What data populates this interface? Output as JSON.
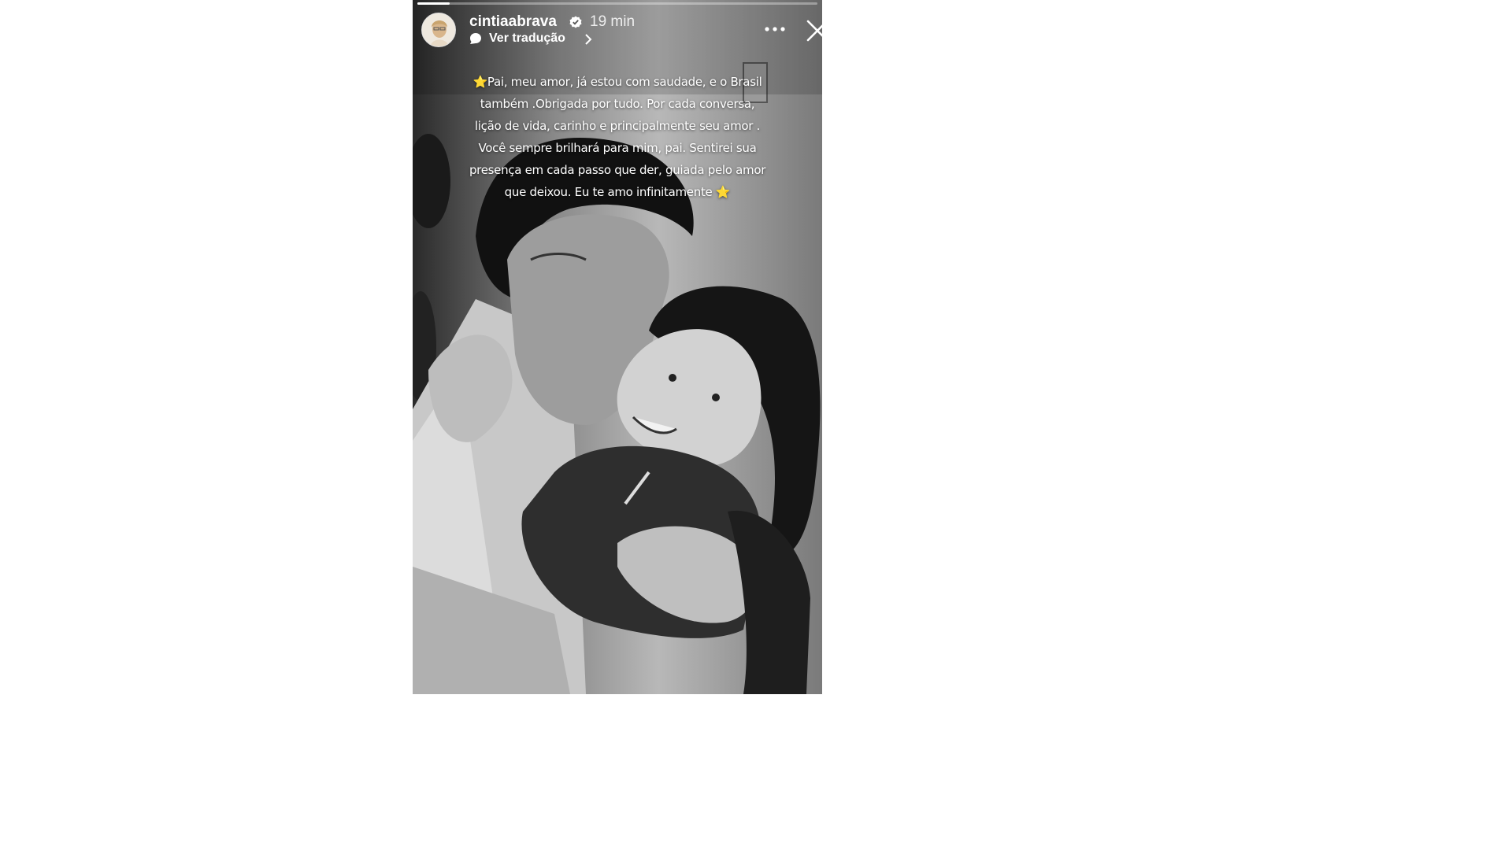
{
  "story": {
    "username": "cintiaabrava",
    "verified": true,
    "time_ago": "19 min",
    "translate_label": "Ver tradução",
    "progress": 0.08,
    "caption": "⭐Pai, meu amor, já estou com saudade, e o Brasil também .Obrigada por tudo. Por cada conversa, lição de vida, carinho e principalmente seu amor . Você sempre brilhará para mim, pai. Sentirei sua presença em cada passo que der, guiada pelo amor que deixou. Eu te amo infinitamente ⭐"
  },
  "icons": {
    "verified": "verified-badge-icon",
    "translate": "speech-bubble-icon",
    "chevron": "chevron-right-icon",
    "more": "more-horizontal-icon",
    "close": "close-icon"
  },
  "colors": {
    "background": "#ffffff",
    "text": "#ffffff",
    "photo_dark": "#1c1c1c",
    "photo_mid": "#6a6a6a"
  }
}
